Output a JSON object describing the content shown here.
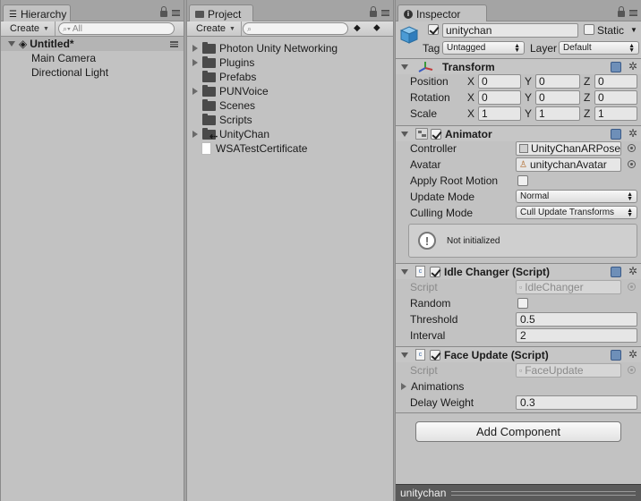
{
  "hierarchy": {
    "tab_label": "Hierarchy",
    "create_label": "Create",
    "search_placeholder": "All",
    "scene_name": "Untitled*",
    "items": [
      "Main Camera",
      "Directional Light"
    ]
  },
  "project": {
    "tab_label": "Project",
    "create_label": "Create",
    "items": [
      {
        "label": "Photon Unity Networking",
        "expandable": true
      },
      {
        "label": "Plugins",
        "expandable": true
      },
      {
        "label": "Prefabs",
        "expandable": false
      },
      {
        "label": "PUNVoice",
        "expandable": true
      },
      {
        "label": "Scenes",
        "expandable": false
      },
      {
        "label": "Scripts",
        "expandable": false
      },
      {
        "label": "UnityChan",
        "expandable": true
      },
      {
        "label": "WSATestCertificate",
        "expandable": false
      }
    ]
  },
  "inspector": {
    "tab_label": "Inspector",
    "object_name": "unitychan",
    "static_label": "Static",
    "tag_label": "Tag",
    "tag_value": "Untagged",
    "layer_label": "Layer",
    "layer_value": "Default",
    "transform": {
      "title": "Transform",
      "rows": [
        {
          "label": "Position",
          "x": "0",
          "y": "0",
          "z": "0"
        },
        {
          "label": "Rotation",
          "x": "0",
          "y": "0",
          "z": "0"
        },
        {
          "label": "Scale",
          "x": "1",
          "y": "1",
          "z": "1"
        }
      ],
      "axis_x": "X",
      "axis_y": "Y",
      "axis_z": "Z"
    },
    "animator": {
      "title": "Animator",
      "controller_label": "Controller",
      "controller_value": "UnityChanARPose",
      "avatar_label": "Avatar",
      "avatar_value": "unitychanAvatar",
      "root_motion_label": "Apply Root Motion",
      "update_mode_label": "Update Mode",
      "update_mode_value": "Normal",
      "culling_mode_label": "Culling Mode",
      "culling_mode_value": "Cull Update Transforms",
      "info_text": "Not initialized"
    },
    "idle_changer": {
      "title": "Idle Changer (Script)",
      "script_label": "Script",
      "script_value": "IdleChanger",
      "random_label": "Random",
      "threshold_label": "Threshold",
      "threshold_value": "0.5",
      "interval_label": "Interval",
      "interval_value": "2"
    },
    "face_update": {
      "title": "Face Update (Script)",
      "script_label": "Script",
      "script_value": "FaceUpdate",
      "animations_label": "Animations",
      "delay_label": "Delay Weight",
      "delay_value": "0.3"
    },
    "add_component_label": "Add Component",
    "footer_label": "unitychan"
  }
}
